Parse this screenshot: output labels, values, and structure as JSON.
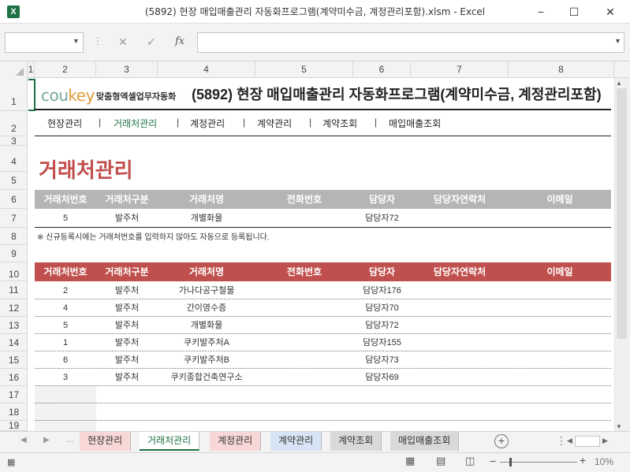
{
  "window": {
    "title": "(5892) 현장 매입매출관리 자동화프로그램(계약미수금, 계정관리포함).xlsm  -  Excel",
    "app_icon": "X",
    "minimize": "−",
    "maximize": "☐",
    "close": "✕"
  },
  "formula_bar": {
    "cancel_icon": "✕",
    "enter_icon": "✓",
    "fx_label": "fx",
    "value": ""
  },
  "columns": [
    "1",
    "2",
    "3",
    "4",
    "5",
    "6",
    "7",
    "8"
  ],
  "rows": [
    "1",
    "2",
    "3",
    "4",
    "5",
    "6",
    "7",
    "8",
    "9",
    "10",
    "11",
    "12",
    "13",
    "14",
    "15",
    "16",
    "17",
    "18",
    "19"
  ],
  "sheet": {
    "logo_main": "cou",
    "logo_accent": "key",
    "logo_sub": "맞춤형엑셀업무자동화",
    "title": "(5892) 현장 매입매출관리 자동화프로그램(계약미수금, 계정관리포함)",
    "nav": [
      "현장관리",
      "거래처관리",
      "계정관리",
      "계약관리",
      "계약조회",
      "매입매출조회"
    ],
    "nav_separator": "|",
    "nav_active_index": 1,
    "section_title": "거래처관리",
    "headers": [
      "거래처번호",
      "거래처구분",
      "거래처명",
      "전화번호",
      "담당자",
      "담당자연락처",
      "이메일"
    ],
    "input_row": {
      "no": "5",
      "type": "발주처",
      "name": "개별화물",
      "phone": "",
      "manager": "담당자72",
      "contact": "",
      "email": ""
    },
    "note": "※ 신규등록시에는 거래처번호를 입력하지 않아도 자동으로 등록됩니다.",
    "list_rows": [
      {
        "no": "2",
        "type": "발주처",
        "name": "가나다공구철물",
        "phone": "",
        "manager": "담당자176",
        "contact": "",
        "email": ""
      },
      {
        "no": "4",
        "type": "발주처",
        "name": "간이영수증",
        "phone": "",
        "manager": "담당자70",
        "contact": "",
        "email": ""
      },
      {
        "no": "5",
        "type": "발주처",
        "name": "개별화물",
        "phone": "",
        "manager": "담당자72",
        "contact": "",
        "email": ""
      },
      {
        "no": "1",
        "type": "발주처",
        "name": "쿠키발주처A",
        "phone": "",
        "manager": "담당자155",
        "contact": "",
        "email": ""
      },
      {
        "no": "6",
        "type": "발주처",
        "name": "쿠키발주처B",
        "phone": "",
        "manager": "담당자73",
        "contact": "",
        "email": ""
      },
      {
        "no": "3",
        "type": "발주처",
        "name": "쿠키종합건축연구소",
        "phone": "",
        "manager": "담당자69",
        "contact": "",
        "email": ""
      }
    ]
  },
  "sheet_tabs": [
    {
      "label": "현장관리",
      "color": "#f8d7d7"
    },
    {
      "label": "거래처관리",
      "color": "#ffffff"
    },
    {
      "label": "계정관리",
      "color": "#f8d7d7"
    },
    {
      "label": "계약관리",
      "color": "#d6e4f5"
    },
    {
      "label": "계약조회",
      "color": "#d9d9d9"
    },
    {
      "label": "매입매출조회",
      "color": "#d9d9d9"
    }
  ],
  "active_tab_index": 1,
  "add_sheet": "+",
  "status": {
    "zoom": "10%",
    "zoom_minus": "−",
    "zoom_plus": "+"
  },
  "colors": {
    "accent_red": "#c0504d",
    "header_gray": "#b5b5b5",
    "excel_green": "#1e7145"
  }
}
